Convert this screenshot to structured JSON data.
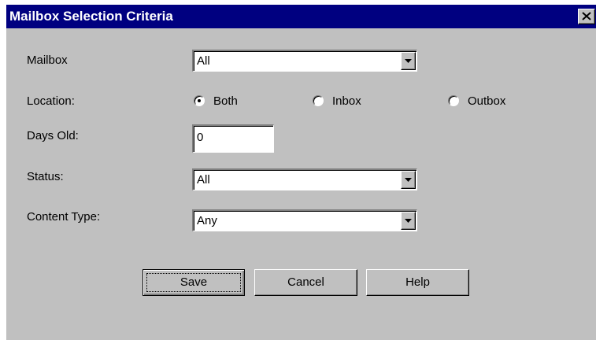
{
  "window": {
    "title": "Mailbox Selection Criteria",
    "titlebar_color": "#000080",
    "background_color": "#c0c0c0"
  },
  "fields": {
    "mailbox": {
      "label": "Mailbox",
      "value": "All"
    },
    "location": {
      "label": "Location:",
      "options": [
        {
          "label": "Both",
          "selected": true
        },
        {
          "label": "Inbox",
          "selected": false
        },
        {
          "label": "Outbox",
          "selected": false
        }
      ]
    },
    "days_old": {
      "label": "Days Old:",
      "value": "0"
    },
    "status": {
      "label": "Status:",
      "value": "All"
    },
    "content_type": {
      "label": "Content Type:",
      "value": "Any"
    }
  },
  "buttons": {
    "save": "Save",
    "cancel": "Cancel",
    "help": "Help"
  },
  "icons": {
    "close": "close-icon",
    "dropdown": "chevron-down-icon"
  }
}
